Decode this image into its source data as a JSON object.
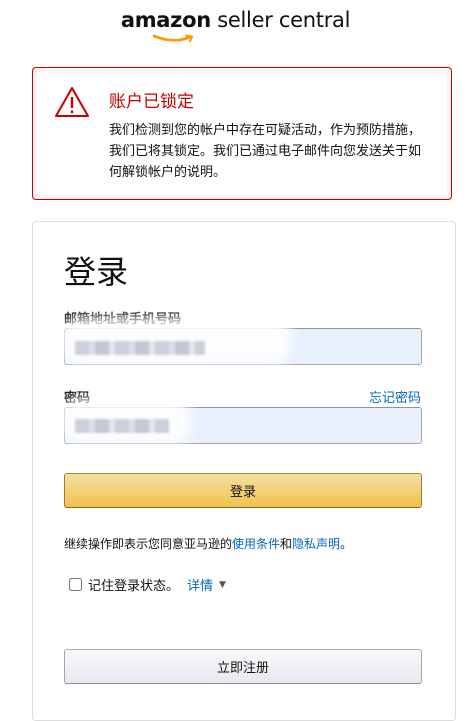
{
  "logo": {
    "brand": "amazon",
    "product": " seller central",
    "smile_icon": "amazon-smile-icon"
  },
  "alert": {
    "icon": "warning-triangle-icon",
    "title": "账户已锁定",
    "body": "我们检测到您的帐户中存在可疑活动，作为预防措施，我们已将其锁定。我们已通过电子邮件向您发送关于如何解锁帐户的说明。"
  },
  "signin": {
    "heading": "登录",
    "email_label": "邮箱地址或手机号码",
    "email_value": "",
    "password_label": "密码",
    "password_value": "",
    "forgot_password": "忘记密码",
    "signin_button": "登录",
    "terms_prefix": "继续操作即表示您同意亚马逊的",
    "terms_link": "使用条件",
    "terms_and": "和",
    "privacy_link": "隐私声明",
    "terms_suffix": "。",
    "remember_label": "记住登录状态。",
    "details_link": "详情",
    "details_caret": "▼",
    "register_button": "立即注册"
  },
  "colors": {
    "alert_red": "#c40000",
    "link_blue": "#0066c0",
    "signin_button": "#f0c14b",
    "input_bg": "#e8f0fe"
  }
}
